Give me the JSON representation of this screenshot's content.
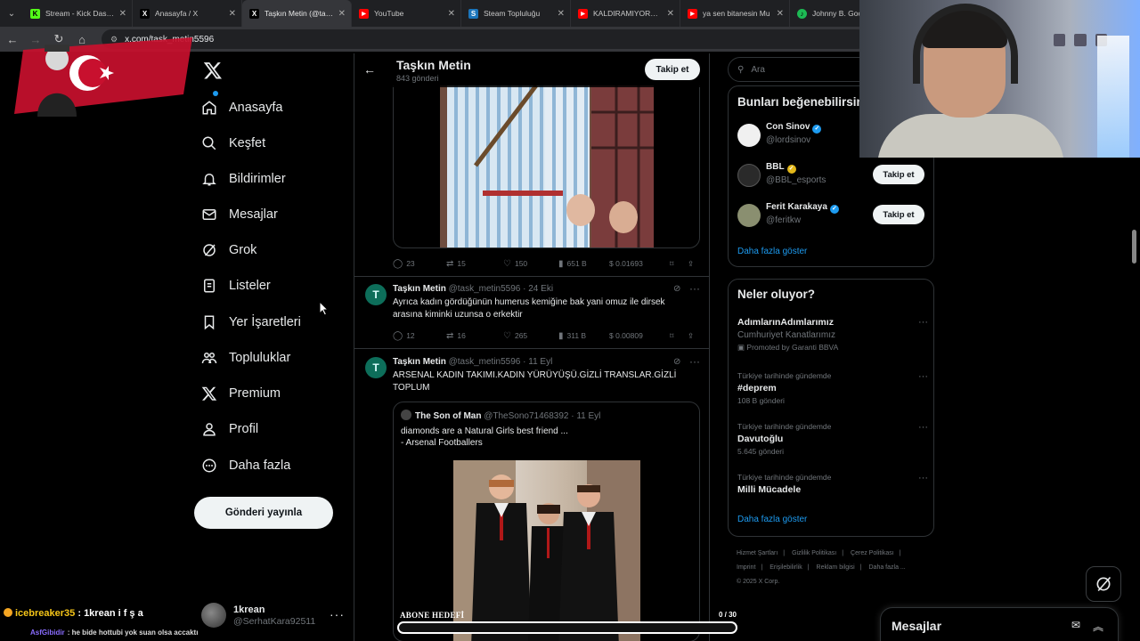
{
  "browser": {
    "tabs": [
      {
        "label": "Stream - Kick Dashbo",
        "favicon_color": "#53fc18",
        "glyph": "K"
      },
      {
        "label": "Anasayfa / X",
        "favicon_color": "#ffffff",
        "glyph": "𝕏"
      },
      {
        "label": "Taşkın Metin (@task_",
        "favicon_color": "#ffffff",
        "glyph": "𝕏"
      },
      {
        "label": "YouTube",
        "favicon_color": "#ff0000",
        "glyph": "▶"
      },
      {
        "label": "Steam Topluluğu",
        "favicon_color": "#1b75bb",
        "glyph": "S"
      },
      {
        "label": "KALDIRAMIYORUM |",
        "favicon_color": "#ff0000",
        "glyph": "▶"
      },
      {
        "label": "ya sen bitanesin Mu",
        "favicon_color": "#ff0000",
        "glyph": "▶"
      },
      {
        "label": "Johnny B. Goode",
        "favicon_color": "#1db954",
        "glyph": "♪"
      }
    ],
    "url": "x.com/task_metin5596"
  },
  "stream_overlay": {
    "chat": [
      {
        "user": "icebreaker35",
        "message": ": 1krean i f ş a"
      },
      {
        "user": "AsfGibidir",
        "message": ": he bide hottubi yok suan olsa accaktı"
      }
    ],
    "goal_label": "ABONE HEDEFİ",
    "goal_count": "0 / 30",
    "goal_progress": 0
  },
  "nav": {
    "items": [
      {
        "label": "Anasayfa",
        "icon": "home-icon"
      },
      {
        "label": "Keşfet",
        "icon": "search-icon"
      },
      {
        "label": "Bildirimler",
        "icon": "bell-icon"
      },
      {
        "label": "Mesajlar",
        "icon": "mail-icon"
      },
      {
        "label": "Grok",
        "icon": "grok-icon"
      },
      {
        "label": "Listeler",
        "icon": "list-icon"
      },
      {
        "label": "Yer İşaretleri",
        "icon": "bookmark-icon"
      },
      {
        "label": "Topluluklar",
        "icon": "communities-icon"
      },
      {
        "label": "Premium",
        "icon": "x-premium-icon"
      },
      {
        "label": "Profil",
        "icon": "profile-icon"
      },
      {
        "label": "Daha fazla",
        "icon": "more-circle-icon"
      }
    ],
    "post_button": "Gönderi yayınla",
    "account": {
      "name": "1krean",
      "handle": "@SerhatKara92511"
    }
  },
  "profile_header": {
    "name": "Taşkın Metin",
    "posts": "843 gönderi",
    "follow": "Takip et"
  },
  "posts": [
    {
      "actions": {
        "replies": "23",
        "reposts": "15",
        "likes": "150",
        "views": "651 B",
        "earnings": "$ 0.01693"
      }
    },
    {
      "avatar": "T",
      "name": "Taşkın Metin",
      "handle": "@task_metin5596 · 24 Eki",
      "text": "Ayrıca kadın gördüğünün humerus kemiğine bak yani omuz ile dirsek arasına kiminki uzunsa o erkektir",
      "actions": {
        "replies": "12",
        "reposts": "16",
        "likes": "265",
        "views": "311 B",
        "earnings": "$ 0.00809"
      }
    },
    {
      "avatar": "T",
      "name": "Taşkın Metin",
      "handle": "@task_metin5596 · 11 Eyl",
      "text": "ARSENAL KADIN TAKIMI.KADIN YÜRÜYÜŞÜ.GİZLİ TRANSLAR.GİZLİ TOPLUM",
      "quote": {
        "name": "The Son of Man",
        "handle": "@TheSono71468392 · 11 Eyl",
        "line1": "diamonds are  a Natural Girls best friend ...",
        "line2": "- Arsenal Footballers"
      }
    }
  ],
  "search": {
    "placeholder": "Ara"
  },
  "who_to_follow": {
    "title": "Bunları beğenebilirsin",
    "users": [
      {
        "name": "Con Sinov",
        "handle": "@lordsinov",
        "badge_color": "#1d9bf0",
        "follow": ""
      },
      {
        "name": "BBL",
        "handle": "@BBL_esports",
        "badge_color": "#e2b719",
        "follow": "Takip et"
      },
      {
        "name": "Ferit Karakaya",
        "handle": "@feritkw",
        "badge_color": "#1d9bf0",
        "follow": "Takip et"
      }
    ],
    "more": "Daha fazla göster"
  },
  "trends": {
    "title": "Neler oluyor?",
    "items": [
      {
        "context": "",
        "title": "AdımlarınAdımlarımız",
        "sub": "Cumhuriyet Kanatlarımız",
        "extra": "Promoted by Garanti BBVA"
      },
      {
        "context": "Türkiye tarihinde gündemde",
        "title": "#deprem",
        "sub": "108 B gönderi",
        "extra": ""
      },
      {
        "context": "Türkiye tarihinde gündemde",
        "title": "Davutoğlu",
        "sub": "5.645 gönderi",
        "extra": ""
      },
      {
        "context": "Türkiye tarihinde gündemde",
        "title": "Milli Mücadele",
        "sub": "",
        "extra": ""
      }
    ],
    "more": "Daha fazla göster"
  },
  "footer": {
    "links": [
      "Hizmet Şartları",
      "Gizlilik Politikası",
      "Çerez Politikası",
      "Imprint",
      "Erişilebilirlik",
      "Reklam bilgisi",
      "Daha fazla ..."
    ],
    "copyright": "© 2025 X Corp."
  },
  "messages_drawer": {
    "title": "Mesajlar"
  }
}
